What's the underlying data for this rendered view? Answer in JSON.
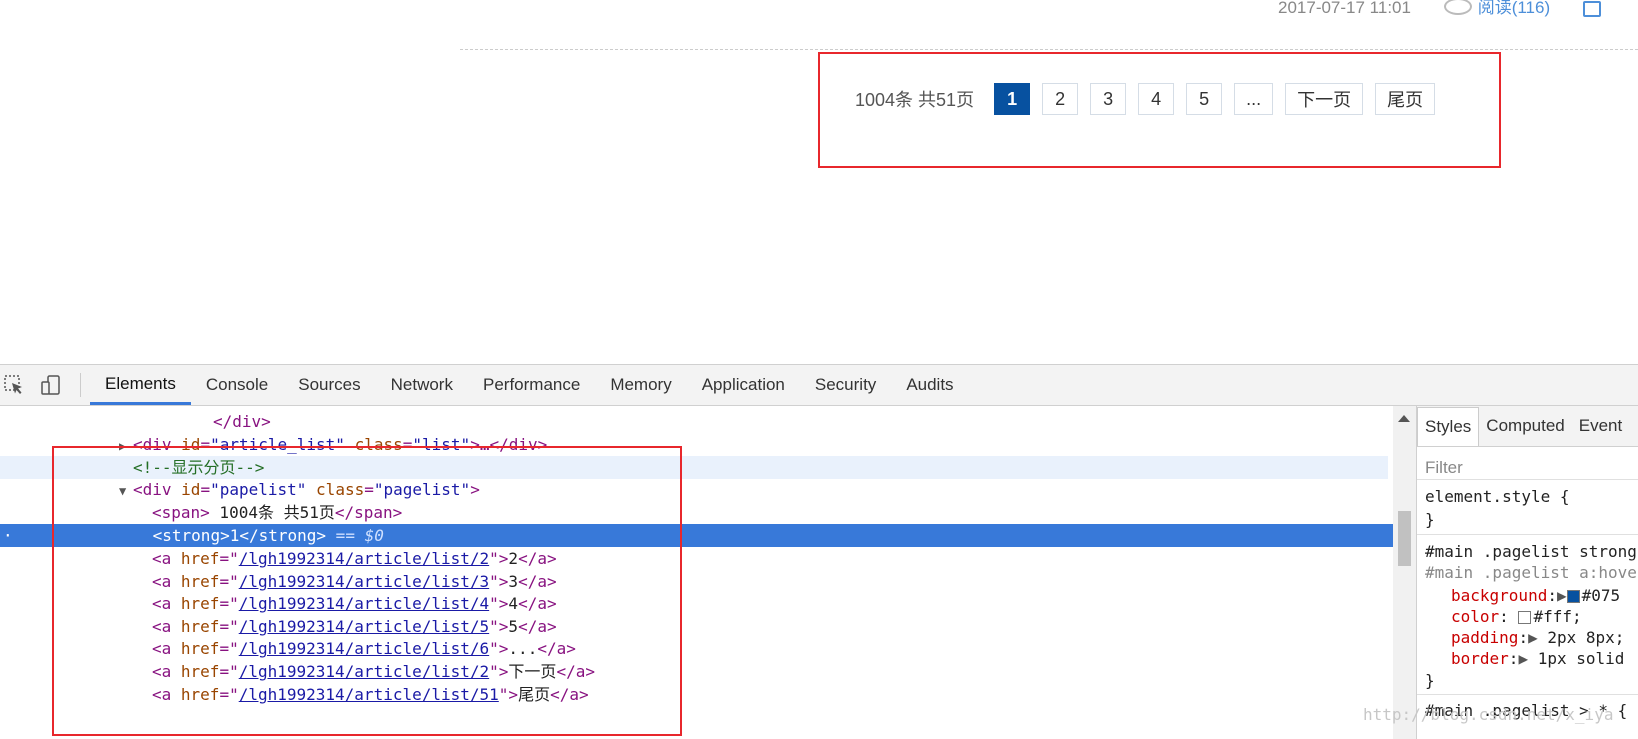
{
  "page": {
    "meta": {
      "date": "2017-07-17 11:01",
      "views": "阅读(116)"
    },
    "pager": {
      "total": "1004条 共51页",
      "items": [
        {
          "label": "1",
          "current": true
        },
        {
          "label": "2",
          "current": false
        },
        {
          "label": "3",
          "current": false
        },
        {
          "label": "4",
          "current": false
        },
        {
          "label": "5",
          "current": false
        },
        {
          "label": "...",
          "current": false
        },
        {
          "label": "下一页",
          "current": false
        },
        {
          "label": "尾页",
          "current": false
        }
      ]
    }
  },
  "devtools": {
    "tabs": [
      "Elements",
      "Console",
      "Sources",
      "Network",
      "Performance",
      "Memory",
      "Application",
      "Security",
      "Audits"
    ],
    "active_tab": "Elements",
    "dom": {
      "l0": "</div>",
      "l1": {
        "tag_open": "<div ",
        "id_attr": "id",
        "id_val": "\"article_list\"",
        "class_attr": "class",
        "class_val": "\"list\"",
        "rest": ">…</div>"
      },
      "l2": "<!--显示分页-->",
      "l3": {
        "tag_open": "<div ",
        "id_attr": "id",
        "id_val": "\"papelist\"",
        "class_attr": "class",
        "class_val": "\"pagelist\"",
        "rest": ">"
      },
      "l4": {
        "open": "<span>",
        "text": " 1004条  共51页",
        "close": "</span>"
      },
      "l5": {
        "open": "<strong>",
        "text": "1",
        "close": "</strong>",
        "eq": " == $0"
      },
      "links": [
        {
          "href": "/lgh1992314/article/list/2",
          "text": "2"
        },
        {
          "href": "/lgh1992314/article/list/3",
          "text": "3"
        },
        {
          "href": "/lgh1992314/article/list/4",
          "text": "4"
        },
        {
          "href": "/lgh1992314/article/list/5",
          "text": "5"
        },
        {
          "href": "/lgh1992314/article/list/6",
          "text": "..."
        },
        {
          "href": "/lgh1992314/article/list/2",
          "text": "下一页"
        },
        {
          "href": "/lgh1992314/article/list/51",
          "text": "尾页"
        }
      ]
    },
    "styles": {
      "tabs": [
        "Styles",
        "Computed",
        "Event"
      ],
      "filter": "Filter",
      "element_style": "element.style {",
      "close_brace": "}",
      "rule1": "#main .pagelist strong",
      "rule2": "#main .pagelist a:hover",
      "props": [
        {
          "name": "background",
          "value": "#075",
          "swatch": "#0751a0"
        },
        {
          "name": "color",
          "value": "#fff;",
          "swatch": "#ffffff"
        },
        {
          "name": "padding",
          "value": "2px 8px;"
        },
        {
          "name": "border",
          "value": "1px solid"
        }
      ],
      "rule3": "#main .pagelist > * {",
      "watermark": "http://blog.csdn.net/x_iya"
    }
  }
}
